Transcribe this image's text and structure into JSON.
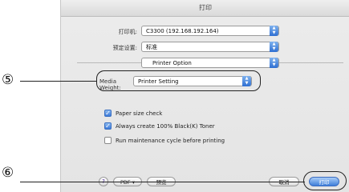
{
  "dialog": {
    "title": "打印",
    "printer_label": "打印机:",
    "printer_value": "C3300 (192.168.192.164)",
    "preset_label": "预定设置:",
    "preset_value": "标准",
    "panel_value": "Printer Option",
    "media_weight_label": "Media Weight:",
    "media_weight_value": "Printer Setting",
    "options": [
      {
        "label": "Paper size check",
        "checked": true
      },
      {
        "label": "Always create 100% Black(K) Toner",
        "checked": true
      },
      {
        "label": "Run maintenance cycle before printing",
        "checked": false
      }
    ],
    "help_glyph": "?",
    "pdf_label": "PDF ▾",
    "preview_label": "预览",
    "cancel_label": "取消",
    "print_label": "打印"
  },
  "callouts": {
    "five": "⑤",
    "six": "⑥"
  },
  "icons": {
    "popup_arrows": "updown-arrows-icon",
    "checkmark": "checkmark-icon",
    "help": "help-icon"
  },
  "colors": {
    "accent_blue": "#3b79d8",
    "dialog_bg": "#e8e8e8"
  }
}
